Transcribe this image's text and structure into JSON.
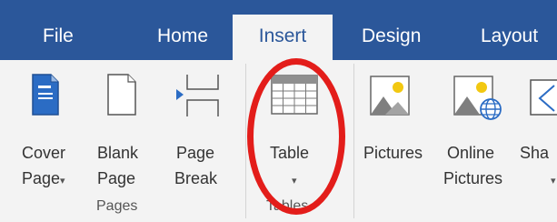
{
  "tabs": [
    {
      "label": "File"
    },
    {
      "label": "Home"
    },
    {
      "label": "Insert"
    },
    {
      "label": "Design"
    },
    {
      "label": "Layout"
    }
  ],
  "active_tab": "Insert",
  "pages_group": {
    "label": "Pages",
    "cover_page": {
      "line1": "Cover",
      "line2": "Page",
      "dropdown": "▾"
    },
    "blank_page": {
      "line1": "Blank",
      "line2": "Page"
    },
    "page_break": {
      "line1": "Page",
      "line2": "Break"
    }
  },
  "tables_group": {
    "label": "Tables",
    "table": {
      "line1": "Table",
      "dropdown": "▾"
    }
  },
  "illustrations": {
    "pictures": {
      "label": "Pictures"
    },
    "online_pictures": {
      "line1": "Online",
      "line2": "Pictures"
    },
    "shapes": {
      "label": "Sha",
      "dropdown": "▾"
    }
  },
  "colors": {
    "tab_bar": "#2b579a",
    "ribbon": "#f3f3f3",
    "highlight_ring": "#e31d1a"
  }
}
